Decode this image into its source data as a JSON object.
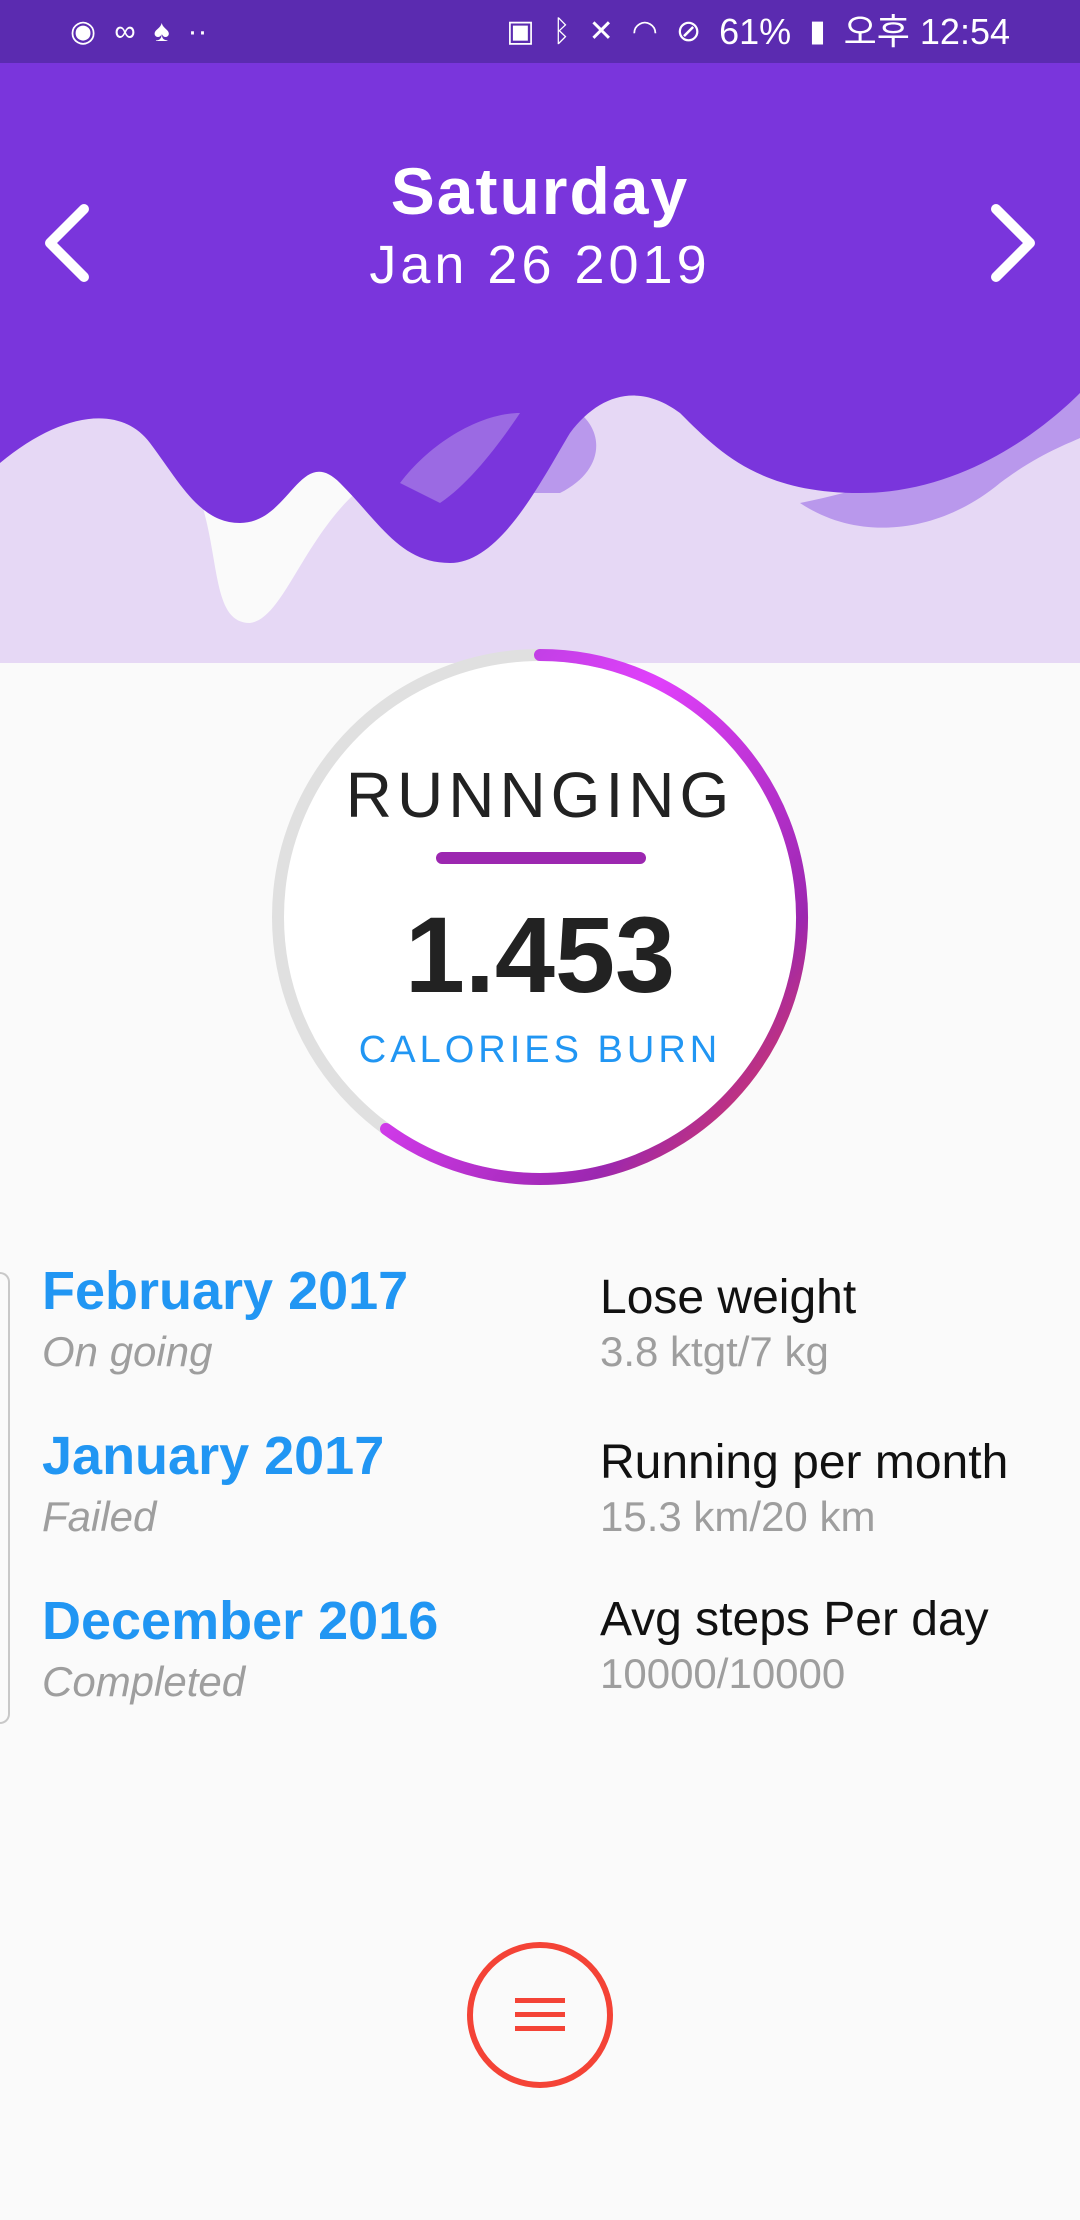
{
  "status_bar": {
    "left_icons": [
      "app-icon",
      "incognito-icon",
      "bot-icon",
      "more-dots-icon"
    ],
    "battery_percent": "61%",
    "time": "오후 12:54",
    "right_icons": [
      "battery-saver-icon",
      "bluetooth-icon",
      "mute-icon",
      "wifi-icon",
      "do-not-disturb-icon",
      "battery-charging-icon"
    ]
  },
  "header": {
    "day": "Saturday",
    "date": "Jan 26 2019",
    "prev_icon": "chevron-left-icon",
    "next_icon": "chevron-right-icon"
  },
  "activity": {
    "name": "RUNNGING",
    "value": "1.453",
    "label": "CALORIES BURN",
    "progress": 0.6
  },
  "history": [
    {
      "month": "February 2017",
      "status": "On going"
    },
    {
      "month": "January 2017",
      "status": "Failed"
    },
    {
      "month": "December 2016",
      "status": "Completed"
    }
  ],
  "goals": [
    {
      "title": "Lose weight",
      "value": "3.8 ktgt/7 kg"
    },
    {
      "title": "Running per month",
      "value": "15.3 km/20 km"
    },
    {
      "title": "Avg steps Per day",
      "value": "10000/10000"
    }
  ],
  "fab": {
    "icon": "menu-icon"
  },
  "colors": {
    "header_purple": "#7a35dc",
    "status_purple": "#5b2bb0",
    "accent_blue": "#2196f3",
    "fab_red": "#f44336",
    "ring_gradient": [
      "#a43fd0",
      "#e040fb",
      "#9c27b0",
      "#f44336"
    ]
  }
}
